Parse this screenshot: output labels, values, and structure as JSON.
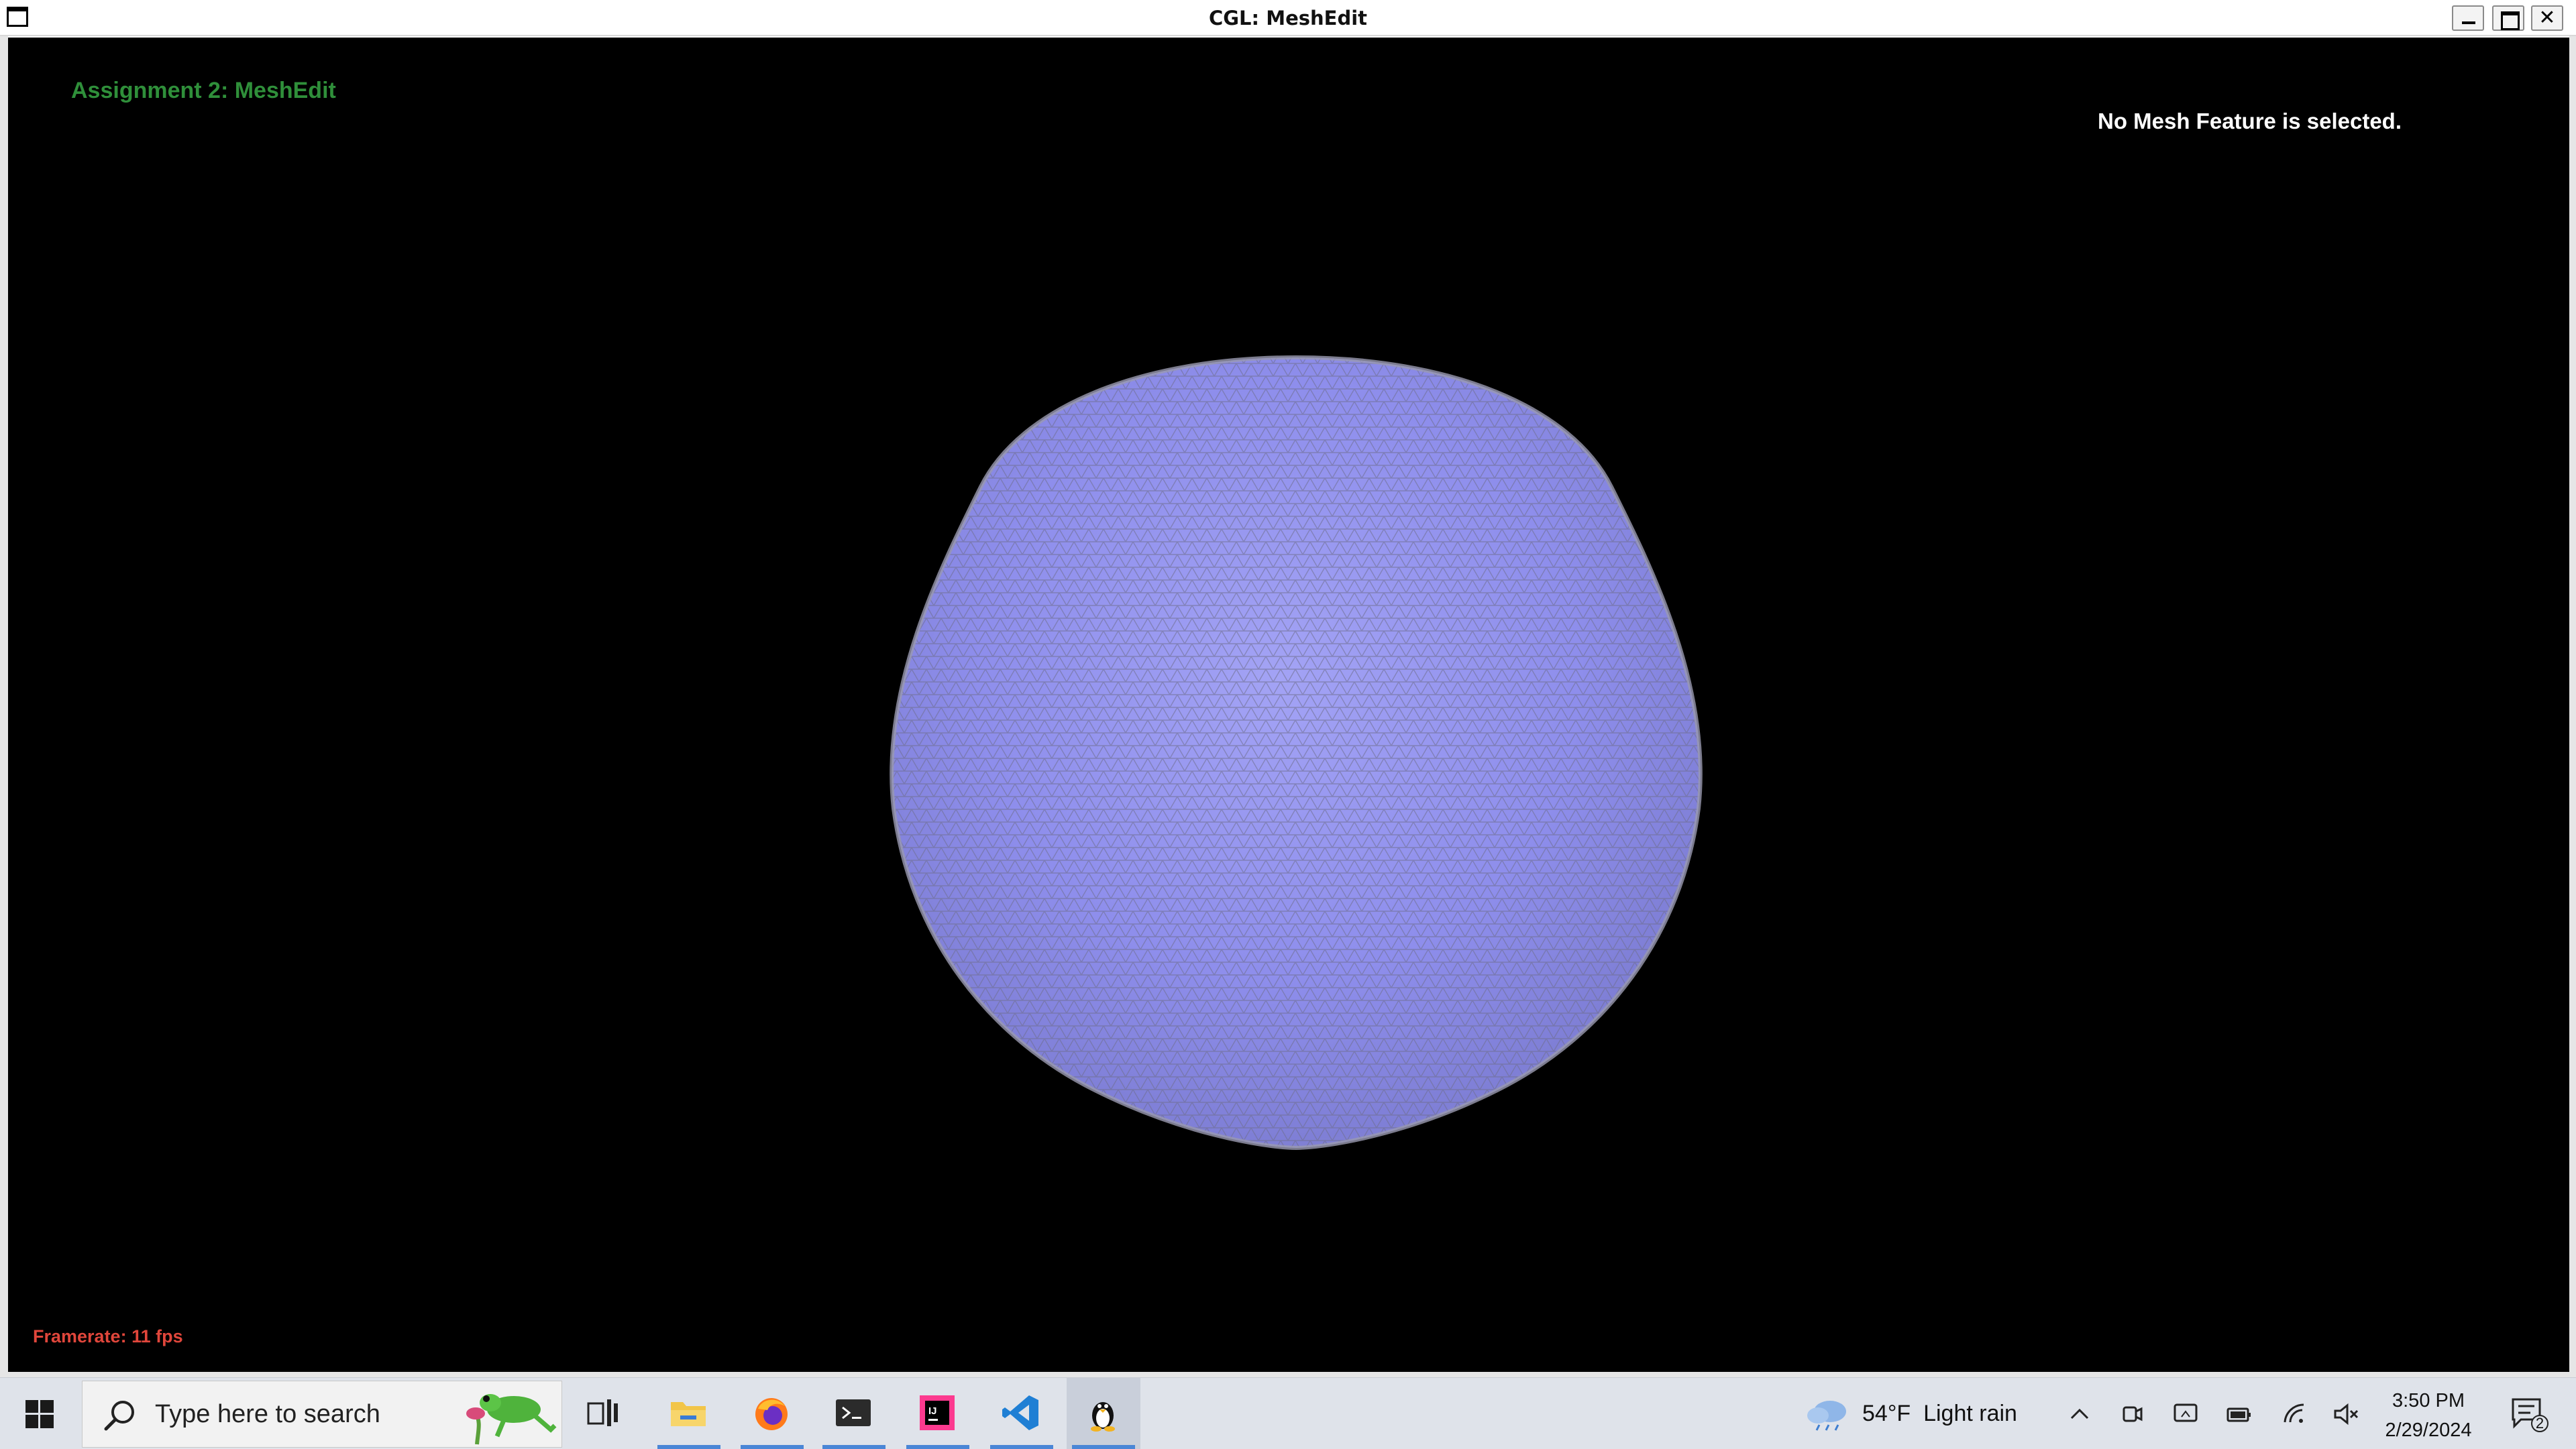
{
  "window": {
    "title": "CGL: MeshEdit",
    "controls": [
      "minimize",
      "maximize",
      "close"
    ]
  },
  "viewport": {
    "hud_title": "Assignment 2: MeshEdit",
    "selection_status": "No Mesh Feature is selected.",
    "framerate": "Framerate: 11 fps",
    "colors": {
      "background": "#000000",
      "hud_title": "#2f8f3a",
      "framerate": "#e0463b",
      "mesh_fill": "#8c8cf0",
      "wireframe": "#7f7f9a"
    },
    "mesh": {
      "icon": "shaded-wireframe-sphere-mesh"
    }
  },
  "taskbar": {
    "start": {
      "icon": "windows-start-icon"
    },
    "search": {
      "placeholder": "Type here to search",
      "icon": "search-icon"
    },
    "pinned": [
      {
        "name": "task-view",
        "icon": "task-view-icon"
      },
      {
        "name": "file-explorer",
        "icon": "folder-icon"
      },
      {
        "name": "firefox",
        "icon": "firefox-icon"
      },
      {
        "name": "terminal",
        "icon": "terminal-icon"
      },
      {
        "name": "intellij",
        "icon": "intellij-icon"
      },
      {
        "name": "vscode",
        "icon": "vscode-icon"
      },
      {
        "name": "linux-app",
        "icon": "tux-icon",
        "active": true
      }
    ],
    "weather": {
      "temp": "54°F",
      "condition": "Light rain",
      "icon": "rain-cloud-icon"
    },
    "tray": [
      "chevron-up-icon",
      "meet-now-icon",
      "display-icon",
      "battery-icon",
      "wifi-icon",
      "volume-muted-icon"
    ],
    "clock": {
      "time": "3:50 PM",
      "date": "2/29/2024"
    },
    "notifications": {
      "count": "2"
    }
  }
}
